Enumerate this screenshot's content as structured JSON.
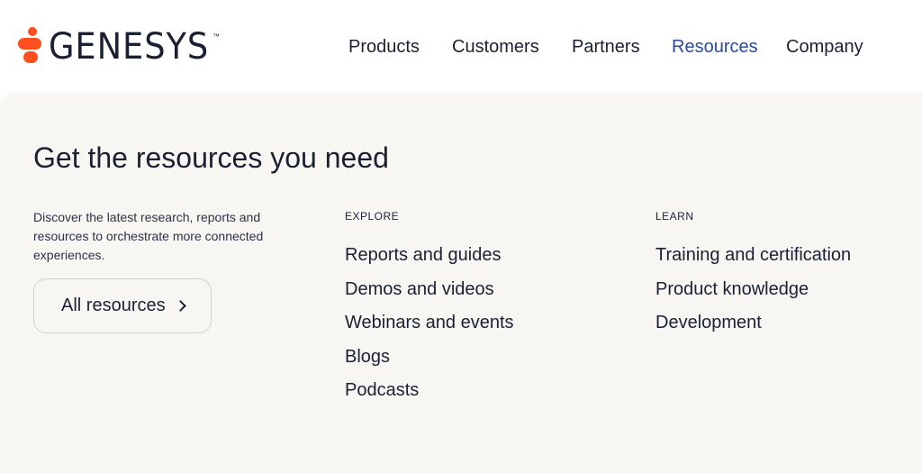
{
  "header": {
    "logo_text": "GENESYS",
    "logo_tm": "™",
    "nav": [
      {
        "label": "Products"
      },
      {
        "label": "Customers"
      },
      {
        "label": "Partners"
      },
      {
        "label": "Resources",
        "active": true
      },
      {
        "label": "Company"
      }
    ]
  },
  "panel": {
    "title": "Get the resources you need",
    "description": "Discover the latest research, reports and resources to orchestrate more connected experiences.",
    "all_button_label": "All resources",
    "explore": {
      "heading": "EXPLORE",
      "links": [
        "Reports and guides",
        "Demos and videos",
        "Webinars and events",
        "Blogs",
        "Podcasts"
      ]
    },
    "learn": {
      "heading": "LEARN",
      "links": [
        "Training and certification",
        "Product knowledge",
        "Development"
      ]
    }
  },
  "colors": {
    "brand_orange": "#ff4f1f",
    "text_dark": "#1b2132",
    "nav_active": "#2a4aa0",
    "panel_bg": "#f7f6f3"
  }
}
